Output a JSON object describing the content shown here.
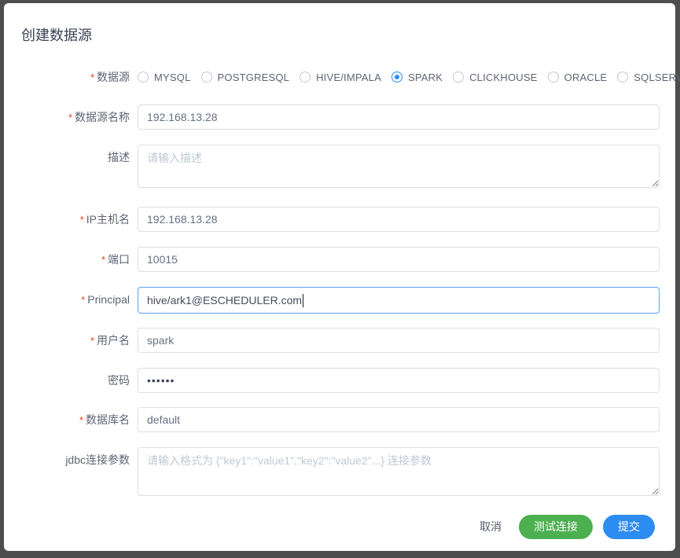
{
  "dialog": {
    "title": "创建数据源",
    "required_mark": "*",
    "form": {
      "type_field": {
        "label": "数据源",
        "required": true,
        "options": [
          {
            "label": "MYSQL",
            "selected": false
          },
          {
            "label": "POSTGRESQL",
            "selected": false
          },
          {
            "label": "HIVE/IMPALA",
            "selected": false
          },
          {
            "label": "SPARK",
            "selected": true
          },
          {
            "label": "CLICKHOUSE",
            "selected": false
          },
          {
            "label": "ORACLE",
            "selected": false
          },
          {
            "label": "SQLSERVER",
            "selected": false
          }
        ]
      },
      "fields": [
        {
          "key": "name",
          "label": "数据源名称",
          "required": true,
          "type": "input",
          "value": "192.168.13.28",
          "placeholder": ""
        },
        {
          "key": "desc",
          "label": "描述",
          "required": false,
          "type": "textarea",
          "value": "",
          "placeholder": "请输入描述"
        },
        {
          "key": "host",
          "label": "IP主机名",
          "required": true,
          "type": "input",
          "value": "192.168.13.28",
          "placeholder": ""
        },
        {
          "key": "port",
          "label": "端口",
          "required": true,
          "type": "input",
          "value": "10015",
          "placeholder": ""
        },
        {
          "key": "principal",
          "label": "Principal",
          "required": true,
          "type": "input",
          "value": "hive/ark1@ESCHEDULER.com",
          "placeholder": "",
          "focused": true
        },
        {
          "key": "user",
          "label": "用户名",
          "required": true,
          "type": "input",
          "value": "spark",
          "placeholder": ""
        },
        {
          "key": "password",
          "label": "密码",
          "required": false,
          "type": "input",
          "value": "••••••",
          "placeholder": ""
        },
        {
          "key": "database",
          "label": "数据库名",
          "required": true,
          "type": "input",
          "value": "default",
          "placeholder": ""
        },
        {
          "key": "jdbc",
          "label": "jdbc连接参数",
          "required": false,
          "type": "textarea",
          "value": "",
          "placeholder": "请输入格式为 {\"key1\":\"value1\",\"key2\":\"value2\"...} 连接参数"
        }
      ]
    },
    "footer": {
      "cancel_label": "取消",
      "test_label": "测试连接",
      "submit_label": "提交"
    },
    "colors": {
      "primary": "#2d8cf0",
      "success": "#4caf50",
      "required": "#ed3f14",
      "focus_border": "#57a3f3",
      "overlay": "#4e4e4e"
    }
  }
}
